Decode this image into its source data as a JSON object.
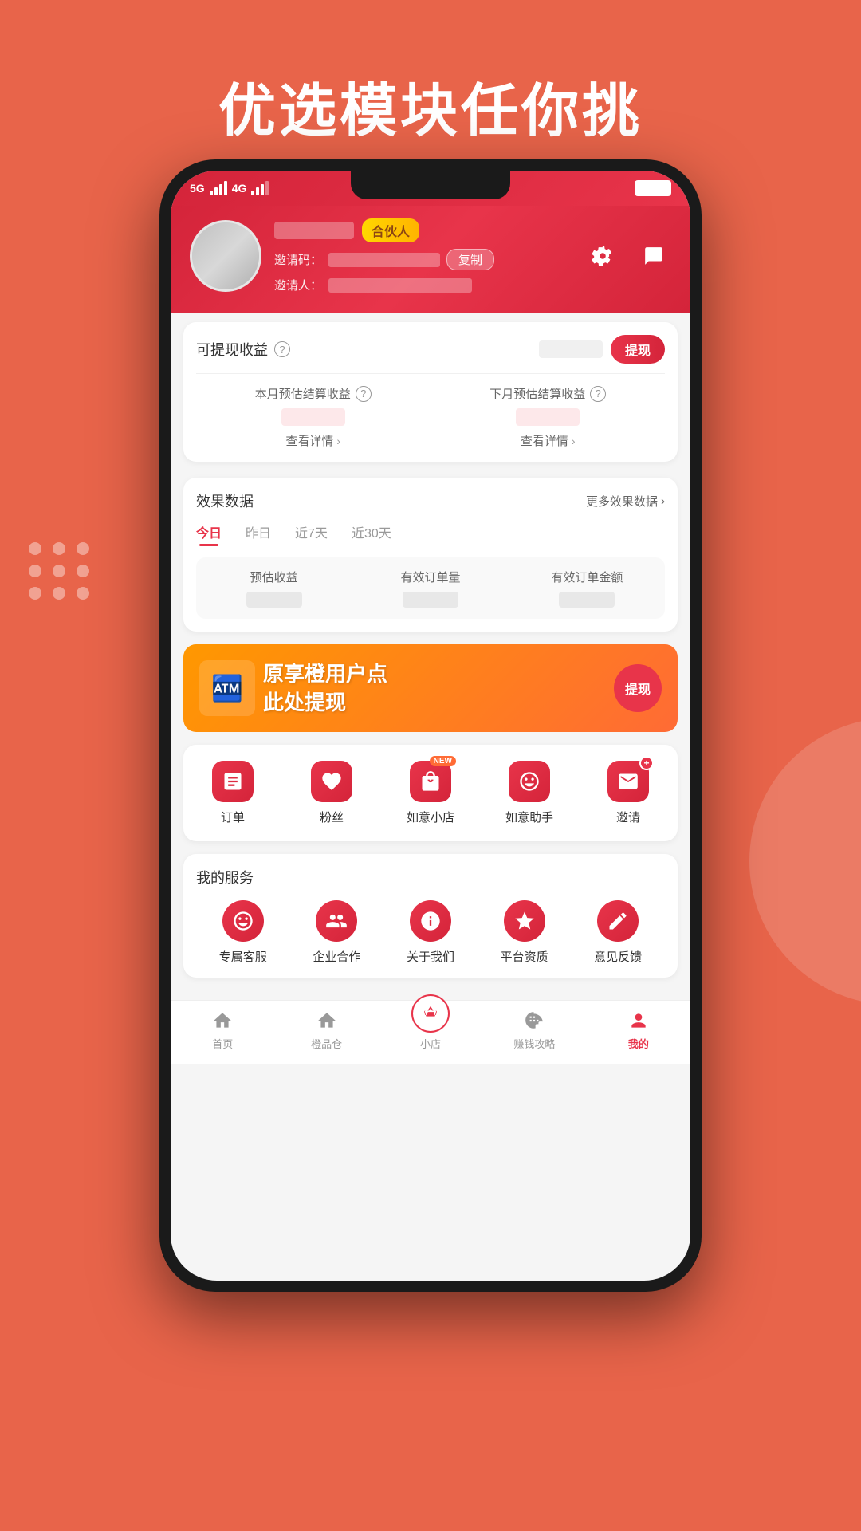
{
  "page": {
    "bg_color": "#e8644a",
    "title": "优选模块任你挑"
  },
  "status_bar": {
    "network": "5G",
    "network2": "4G"
  },
  "profile": {
    "partner_label": "合伙人",
    "invite_code_label": "邀请码：",
    "copy_label": "复制",
    "inviter_label": "邀请人："
  },
  "earnings": {
    "title": "可提现收益",
    "withdraw_btn": "提现",
    "this_month_label": "本月预估结算收益",
    "next_month_label": "下月预估结算收益",
    "view_detail": "查看详情"
  },
  "effect_data": {
    "title": "效果数据",
    "more_label": "更多效果数据",
    "tabs": [
      "今日",
      "昨日",
      "近7天",
      "近30天"
    ],
    "stats": [
      {
        "label": "预估收益"
      },
      {
        "label": "有效订单量"
      },
      {
        "label": "有效订单金额"
      }
    ]
  },
  "banner": {
    "text_line1": "原享橙用户点",
    "text_line2": "此处提现",
    "btn_label": "提现"
  },
  "quick_menu": {
    "items": [
      {
        "label": "订单",
        "icon": "☰",
        "has_new": false
      },
      {
        "label": "粉丝",
        "icon": "♥",
        "has_new": false
      },
      {
        "label": "如意小店",
        "icon": "🏪",
        "has_new": true
      },
      {
        "label": "如意助手",
        "icon": "😊",
        "has_new": false
      },
      {
        "label": "邀请",
        "icon": "✉",
        "has_new": false
      }
    ]
  },
  "my_services": {
    "title": "我的服务",
    "items": [
      {
        "label": "专属客服",
        "icon": "😊"
      },
      {
        "label": "企业合作",
        "icon": "🤝"
      },
      {
        "label": "关于我们",
        "icon": "ℹ"
      },
      {
        "label": "平台资质",
        "icon": "⭐"
      },
      {
        "label": "意见反馈",
        "icon": "✏"
      }
    ]
  },
  "bottom_nav": {
    "items": [
      {
        "label": "首页",
        "icon": "⌂",
        "active": false
      },
      {
        "label": "橙品仓",
        "icon": "⌂",
        "active": false
      },
      {
        "label": "小店",
        "icon": "◇",
        "active": false,
        "center": true
      },
      {
        "label": "赚钱攻略",
        "icon": "$",
        "active": false
      },
      {
        "label": "我的",
        "icon": "👤",
        "active": true
      }
    ]
  }
}
